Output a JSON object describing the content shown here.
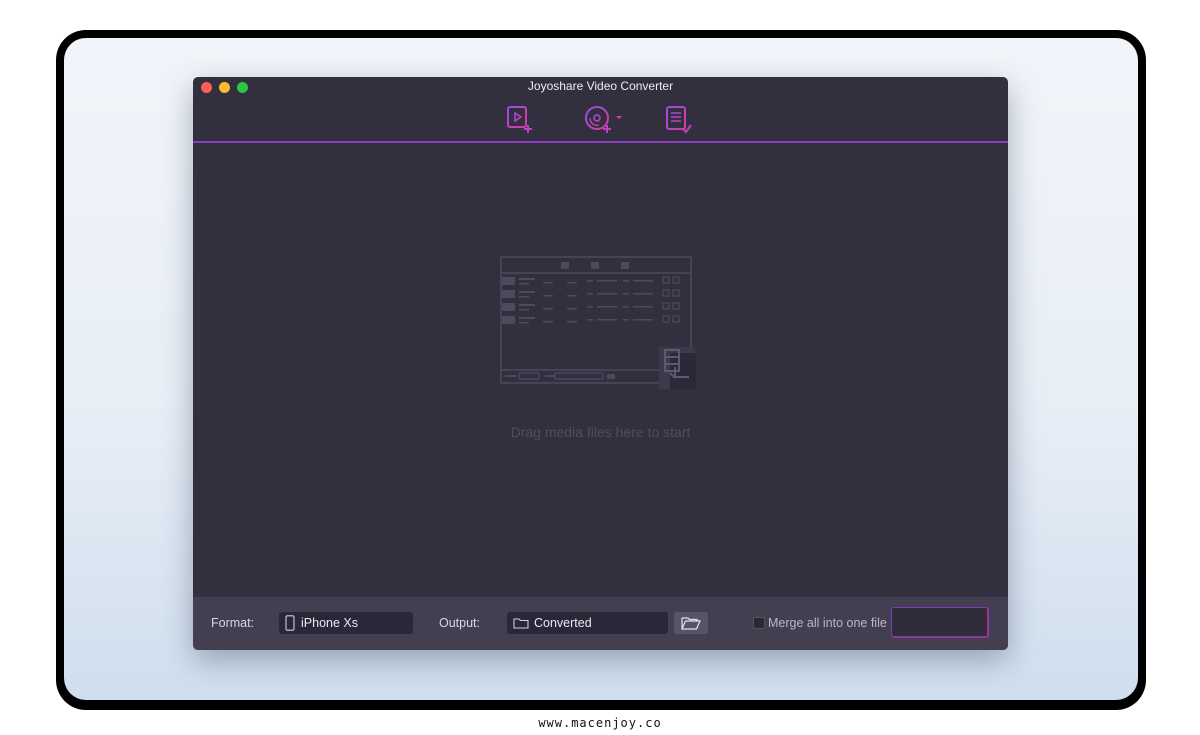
{
  "window": {
    "title": "Joyoshare Video Converter"
  },
  "toolbar": {
    "add_files_icon": "add-media-icon",
    "load_dvd_icon": "dvd-plus-icon",
    "history_icon": "task-list-check-icon"
  },
  "droparea": {
    "hint": "Drag media files here to start"
  },
  "bottom": {
    "format_label": "Format:",
    "format_value": "iPhone Xs",
    "output_label": "Output:",
    "output_value": "Converted",
    "merge_label": "Merge all into one file",
    "convert_label": ""
  },
  "colors": {
    "window_bg": "#32303f",
    "bottom_bar_bg": "#433f50",
    "accent_purple": "#8a3fc5",
    "accent_pink": "#c02a6e"
  },
  "footer": {
    "site": "www.macenjoy.co"
  }
}
